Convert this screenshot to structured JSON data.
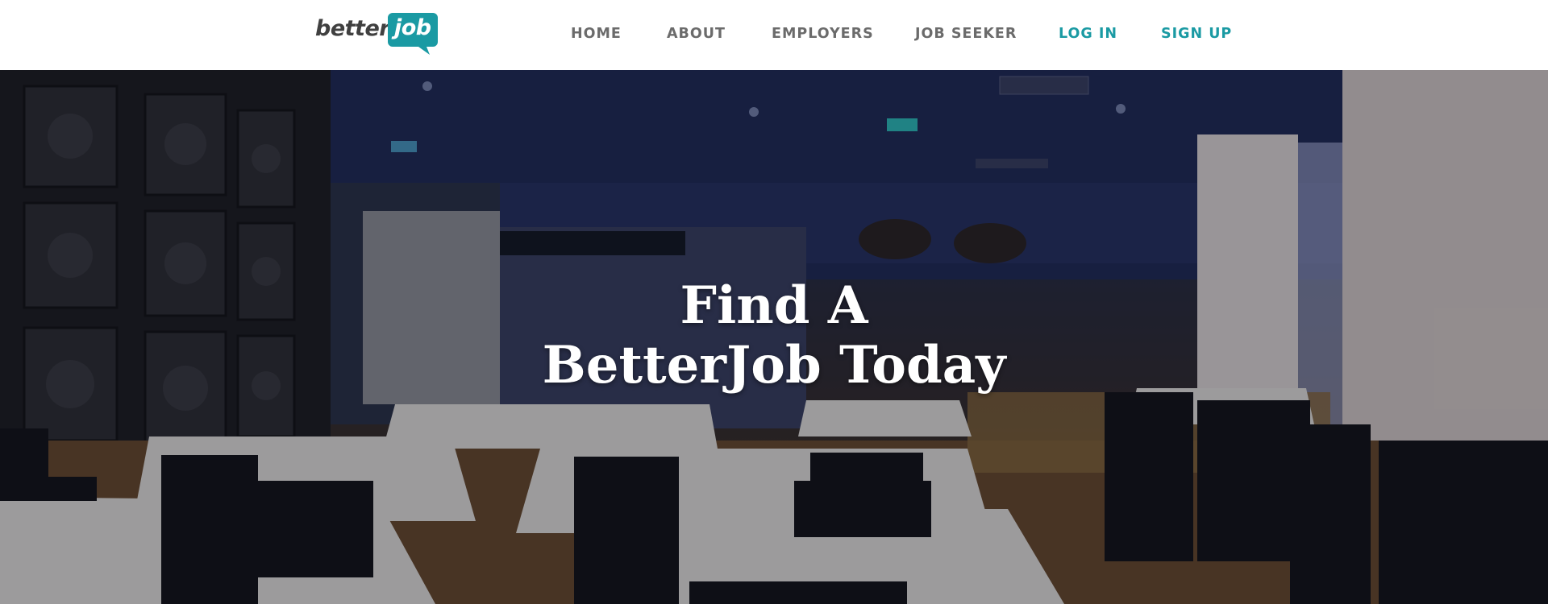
{
  "header": {
    "logo": {
      "text_part": "better",
      "bubble_part": "job",
      "accent_color": "#1a9aa3"
    },
    "nav": [
      {
        "label": "HOME",
        "style": "default"
      },
      {
        "label": "ABOUT",
        "style": "default"
      },
      {
        "label": "EMPLOYERS",
        "style": "default"
      },
      {
        "label": "JOB SEEKER",
        "style": "default"
      },
      {
        "label": "LOG IN",
        "style": "accent"
      },
      {
        "label": "SIGN UP",
        "style": "accent"
      }
    ]
  },
  "hero": {
    "title_line1": "Find A",
    "title_line2": "BetterJob Today",
    "background": "restaurant interior photo"
  },
  "colors": {
    "accent": "#1a9aa3",
    "nav_text": "#6b6b6b",
    "hero_text": "#ffffff"
  }
}
